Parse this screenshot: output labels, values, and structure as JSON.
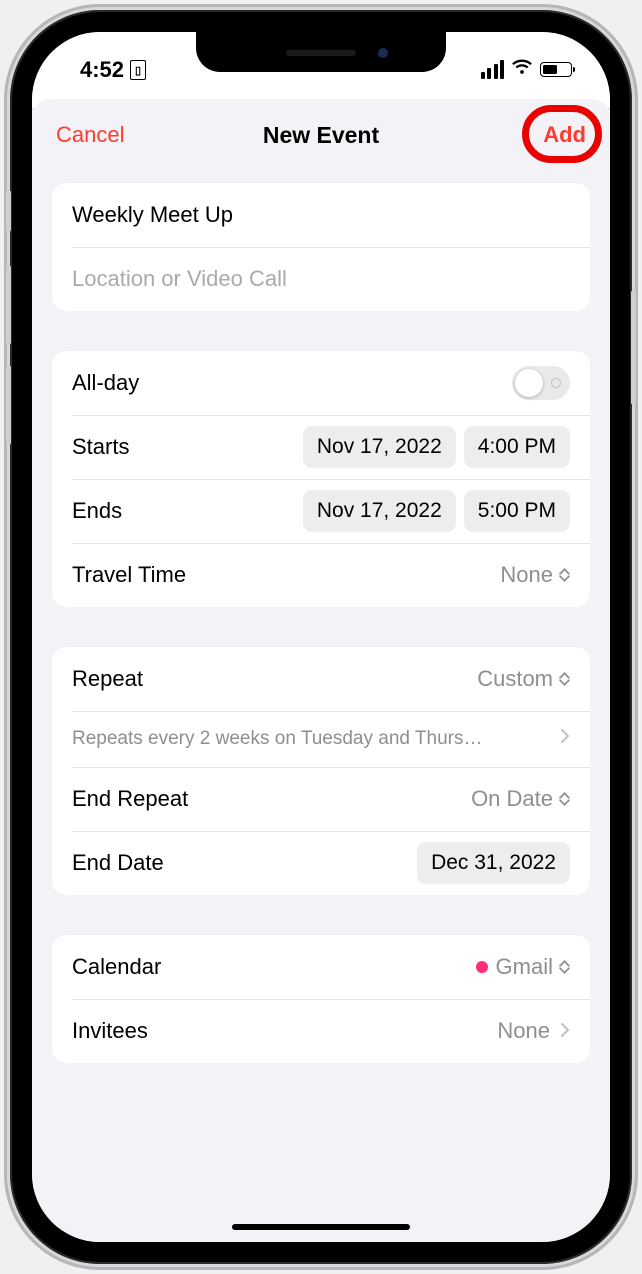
{
  "status": {
    "time": "4:52",
    "battery_pct": 52
  },
  "nav": {
    "cancel": "Cancel",
    "title": "New Event",
    "add": "Add"
  },
  "event": {
    "title_value": "Weekly Meet Up",
    "location_placeholder": "Location or Video Call"
  },
  "time": {
    "allday_label": "All-day",
    "starts_label": "Starts",
    "starts_date": "Nov 17, 2022",
    "starts_time": "4:00 PM",
    "ends_label": "Ends",
    "ends_date": "Nov 17, 2022",
    "ends_time": "5:00 PM",
    "travel_label": "Travel Time",
    "travel_value": "None"
  },
  "repeat": {
    "label": "Repeat",
    "value": "Custom",
    "summary": "Repeats every 2 weeks on Tuesday and Thurs…",
    "end_repeat_label": "End Repeat",
    "end_repeat_value": "On Date",
    "end_date_label": "End Date",
    "end_date_value": "Dec 31, 2022"
  },
  "calendar": {
    "label": "Calendar",
    "value": "Gmail",
    "invitees_label": "Invitees",
    "invitees_value": "None"
  }
}
